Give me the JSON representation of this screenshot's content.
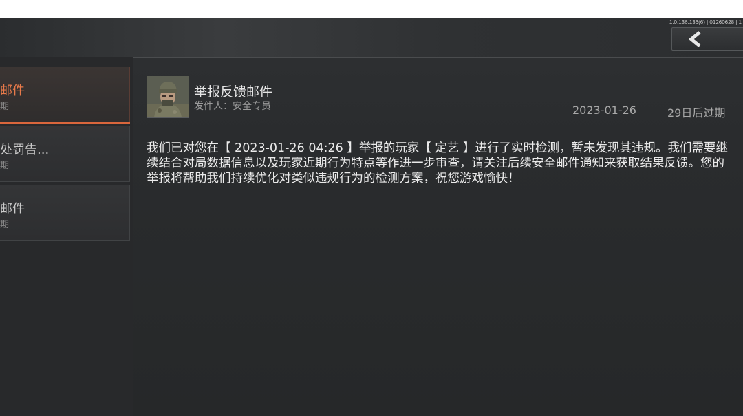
{
  "version": "1.0.136.136(6) | 01260628 | 1",
  "back_icon": "chevron-left-icon",
  "mail_list": [
    {
      "title": "邮件",
      "sub": "期",
      "active": true
    },
    {
      "title": "处罚告...",
      "sub": "期",
      "active": false
    },
    {
      "title": "邮件",
      "sub": "期",
      "active": false
    }
  ],
  "mail": {
    "subject": "举报反馈邮件",
    "sender": "发件人：安全专员",
    "date": "2023-01-26",
    "expire": "29日后过期",
    "body": "我们已对您在【 2023-01-26 04:26 】举报的玩家【 定艺 】进行了实时检测，暂未发现其违规。我们需要继续结合对局数据信息以及玩家近期行为特点等作进一步审查，请关注后续安全邮件通知来获取结果反馈。您的举报将帮助我们持续优化对类似违规行为的检测方案，祝您游戏愉快！"
  },
  "colors": {
    "accent": "#d9663c",
    "active_title": "#e87a4a",
    "background": "#2a2c2e"
  }
}
